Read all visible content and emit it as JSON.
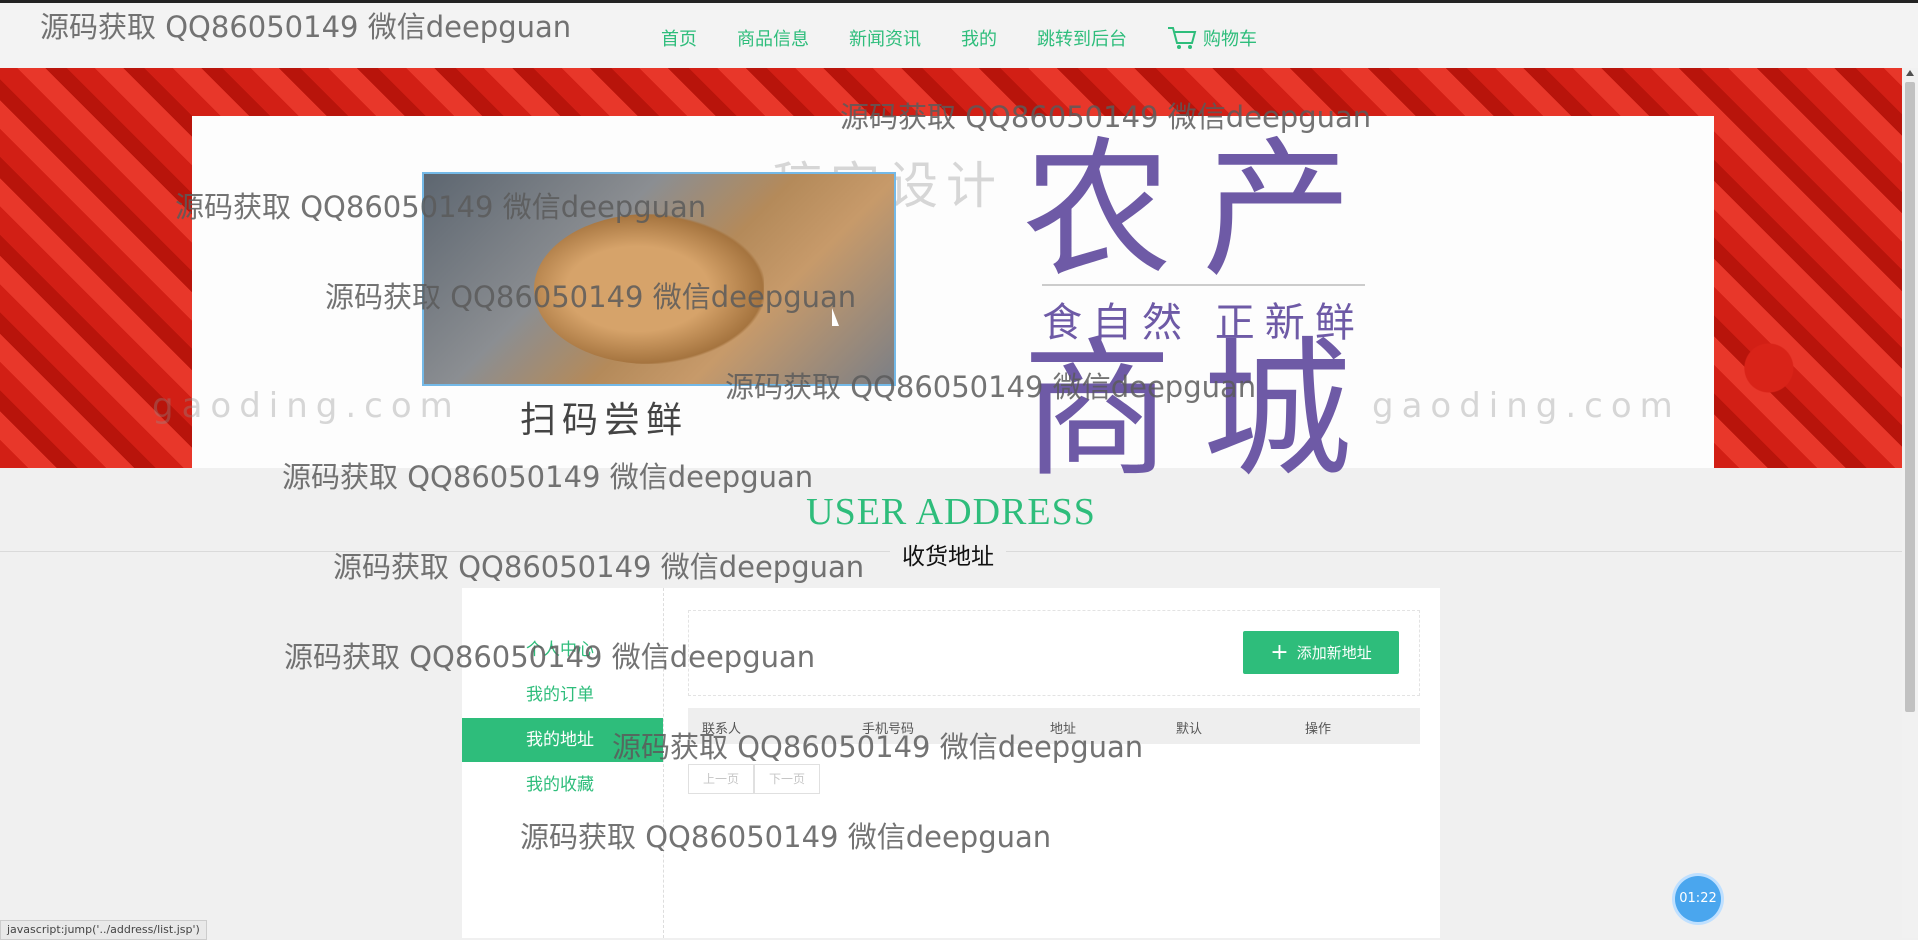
{
  "nav": {
    "items": [
      "首页",
      "商品信息",
      "新闻资讯",
      "我的",
      "跳转到后台"
    ],
    "cart_label": "购物车"
  },
  "banner": {
    "scan_label": "扫码尝鲜",
    "title_line1": "农产",
    "slogan": "食自然 正新鲜",
    "title_line2": "商城",
    "logo_watermark_1": "稿定设计",
    "logo_watermark_2": "gaoding.com"
  },
  "section": {
    "title_en": "USER ADDRESS",
    "title_cn": "收货地址"
  },
  "sidebar": {
    "items": [
      {
        "label": "个人中心",
        "active": false
      },
      {
        "label": "我的订单",
        "active": false
      },
      {
        "label": "我的地址",
        "active": true
      },
      {
        "label": "我的收藏",
        "active": false
      }
    ]
  },
  "toolbar": {
    "add_label": "添加新地址"
  },
  "table": {
    "headers": [
      "联系人",
      "手机号码",
      "地址",
      "默认",
      "操作"
    ]
  },
  "pager": {
    "prev": "上一页",
    "next": "下一页"
  },
  "timer": "01:22",
  "status_bar": "javascript:jump('../address/list.jsp')",
  "watermark": "源码获取 QQ86050149 微信deepguan",
  "colors": {
    "accent": "#2ebd7b",
    "brand_purple": "#6e5aa6",
    "timer_blue": "#4aa6ee"
  }
}
